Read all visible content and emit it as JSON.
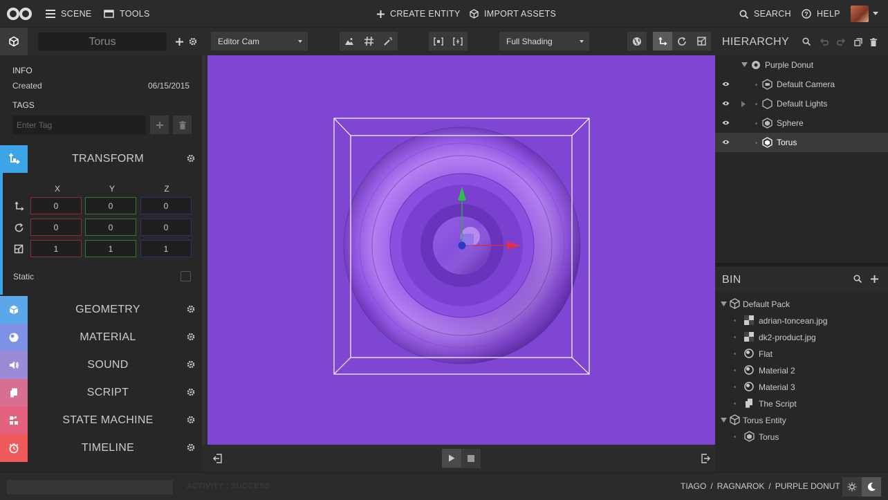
{
  "topbar": {
    "scene_label": "SCENE",
    "tools_label": "TOOLS",
    "create_entity_label": "CREATE ENTITY",
    "import_assets_label": "IMPORT ASSETS",
    "search_label": "SEARCH",
    "help_label": "HELP"
  },
  "inspector": {
    "entity_name": "Torus",
    "info_title": "INFO",
    "created_label": "Created",
    "created_date": "06/15/2015",
    "tags_title": "TAGS",
    "tag_placeholder": "Enter Tag",
    "transform": {
      "title": "TRANSFORM",
      "axes": [
        "X",
        "Y",
        "Z"
      ],
      "translation": [
        "0",
        "0",
        "0"
      ],
      "rotation": [
        "0",
        "0",
        "0"
      ],
      "scale": [
        "1",
        "1",
        "1"
      ],
      "static_label": "Static",
      "static_checked": false
    },
    "sections": [
      "GEOMETRY",
      "MATERIAL",
      "SOUND",
      "SCRIPT",
      "STATE MACHINE",
      "TIMELINE"
    ],
    "section_colors": [
      "#5ba7ea",
      "#7d92e5",
      "#9b8ad6",
      "#d86e90",
      "#e5607e",
      "#f05a5a"
    ],
    "transform_color": "#3ea4e8"
  },
  "viewport_toolbar": {
    "camera": "Editor Cam",
    "shading": "Full Shading"
  },
  "viewport": {
    "background": "#7f45d3"
  },
  "hierarchy": {
    "title": "HIERARCHY",
    "root": "Purple Donut",
    "items": [
      "Default Camera",
      "Default Lights",
      "Sphere",
      "Torus"
    ],
    "selected": "Torus"
  },
  "bin": {
    "title": "BIN",
    "packs": [
      {
        "name": "Default Pack",
        "items": [
          "adrian-toncean.jpg",
          "dk2-product.jpg",
          "Flat",
          "Material 2",
          "Material 3",
          "The Script"
        ]
      },
      {
        "name": "Torus Entity",
        "items": [
          "Torus"
        ]
      }
    ]
  },
  "footer": {
    "activity": "ACTIVITY : SUCCESS",
    "crumbs": [
      "TIAGO",
      "RAGNAROK",
      "PURPLE DONUT"
    ],
    "sep": "/"
  }
}
